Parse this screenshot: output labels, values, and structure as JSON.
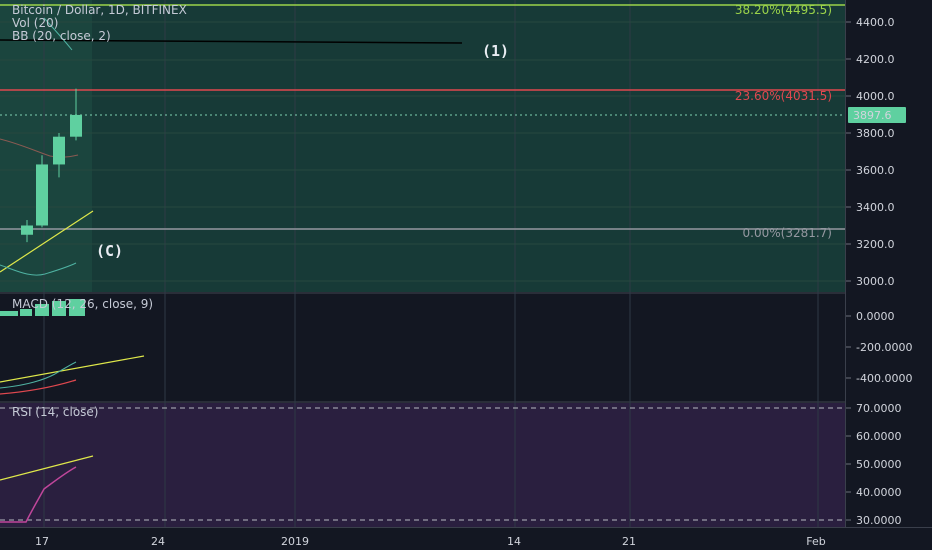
{
  "header": {
    "symbol_line": "Bitcoin / Dollar, 1D, BITFINEX",
    "vol_label": "Vol (20)",
    "bb_label": "BB (20, close, 2)",
    "macd_label": "MACD (12, 26, close, 9)",
    "rsi_label": "RSI (14, close)"
  },
  "annotations": {
    "wave_1": "(1)",
    "wave_c": "(C)"
  },
  "price_badge": "3897.6",
  "chart_data": [
    {
      "type": "candlestick",
      "pane": "price",
      "ylim": [
        2920,
        4530
      ],
      "y_ticks": [
        "3000.0",
        "3200.0",
        "3400.0",
        "3600.0",
        "3800.0",
        "4000.0",
        "4200.0",
        "4400.0"
      ],
      "y_tick_values": [
        3000,
        3200,
        3400,
        3600,
        3800,
        4000,
        4200,
        4400
      ],
      "x_ticks": [
        "17",
        "24",
        "2019",
        "14",
        "21",
        "Feb"
      ],
      "candles": [
        {
          "open": 3250,
          "high": 3330,
          "low": 3210,
          "close": 3300,
          "up": true
        },
        {
          "open": 3300,
          "high": 3680,
          "low": 3290,
          "close": 3630,
          "up": true
        },
        {
          "open": 3630,
          "high": 3800,
          "low": 3560,
          "close": 3780,
          "up": true
        },
        {
          "open": 3780,
          "high": 4040,
          "low": 3760,
          "close": 3897.6,
          "up": true
        }
      ],
      "fib_levels": [
        {
          "label": "38.20%(4495.5)",
          "value": 4495.5,
          "color": "#9bd34a"
        },
        {
          "label": "23.60%(4031.5)",
          "value": 4031.5,
          "color": "#e0484f"
        },
        {
          "label": "0.00%(3281.7)",
          "value": 3281.7,
          "color": "#9598a1"
        }
      ],
      "last_price": 3897.6
    },
    {
      "type": "line",
      "pane": "macd",
      "ylim": [
        -480,
        80
      ],
      "y_ticks": [
        "0.0000",
        "-200.0000",
        "-400.0000"
      ],
      "y_tick_values": [
        0,
        -200,
        -400
      ]
    },
    {
      "type": "line",
      "pane": "rsi",
      "ylim": [
        27,
        73
      ],
      "y_ticks": [
        "70.0000",
        "60.0000",
        "50.0000",
        "40.0000",
        "30.0000"
      ],
      "y_tick_values": [
        70,
        60,
        50,
        40,
        30
      ],
      "bands": [
        70,
        30
      ]
    }
  ],
  "colors": {
    "background": "#131722",
    "price_pane": "#173a37",
    "rsi_pane": "#2a1f3f",
    "up_candle": "#5fd0a0",
    "fib_382": "#9bd34a",
    "fib_236": "#e0484f",
    "fib_0": "#9598a1",
    "trend_line": "#dfe84a"
  }
}
